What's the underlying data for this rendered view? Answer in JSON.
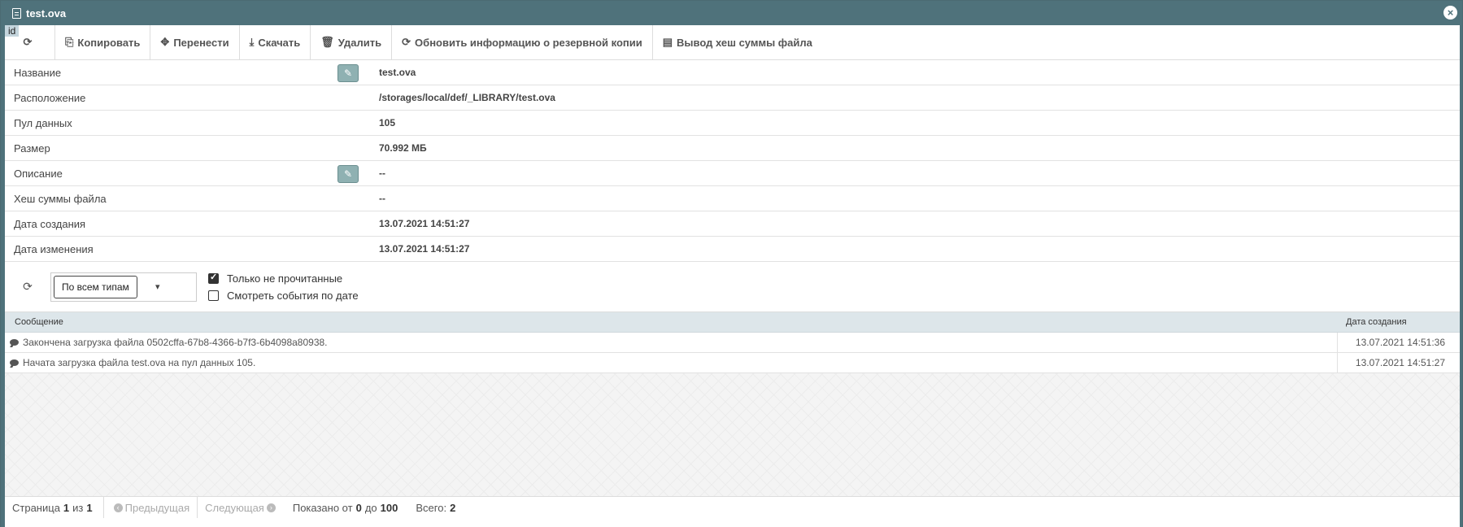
{
  "window": {
    "title": "test.ova",
    "id_badge": "id"
  },
  "toolbar": {
    "copy": "Копировать",
    "move": "Перенести",
    "download": "Скачать",
    "delete": "Удалить",
    "refresh_backup": "Обновить информацию о резервной копии",
    "hash": "Вывод хеш суммы файла"
  },
  "props": [
    {
      "label": "Название",
      "value": "test.ova"
    },
    {
      "label": "Расположение",
      "value": "/storages/local/def/_LIBRARY/test.ova"
    },
    {
      "label": "Пул данных",
      "value": "105"
    },
    {
      "label": "Размер",
      "value": "70.992 МБ"
    },
    {
      "label": "Описание",
      "value": "--"
    },
    {
      "label": "Хеш суммы файла",
      "value": "--"
    },
    {
      "label": "Дата создания",
      "value": "13.07.2021 14:51:27"
    },
    {
      "label": "Дата изменения",
      "value": "13.07.2021 14:51:27"
    }
  ],
  "filters": {
    "type_select": "По всем типам",
    "only_unread": "Только не прочитанные",
    "by_date": "Смотреть события по дате"
  },
  "grid": {
    "col_message": "Сообщение",
    "col_date": "Дата создания",
    "rows": [
      {
        "message": "Закончена загрузка файла 0502cffa-67b8-4366-b7f3-6b4098a80938.",
        "date": "13.07.2021 14:51:36"
      },
      {
        "message": "Начата загрузка файла test.ova на пул данных 105.",
        "date": "13.07.2021 14:51:27"
      }
    ]
  },
  "pager": {
    "page_label": "Страница",
    "page": "1",
    "of": "из",
    "pages": "1",
    "prev": "Предыдущая",
    "next": "Следующая",
    "shown_label": "Показано от",
    "from": "0",
    "to_label": "до",
    "to": "100",
    "total_label": "Всего:",
    "total": "2"
  }
}
